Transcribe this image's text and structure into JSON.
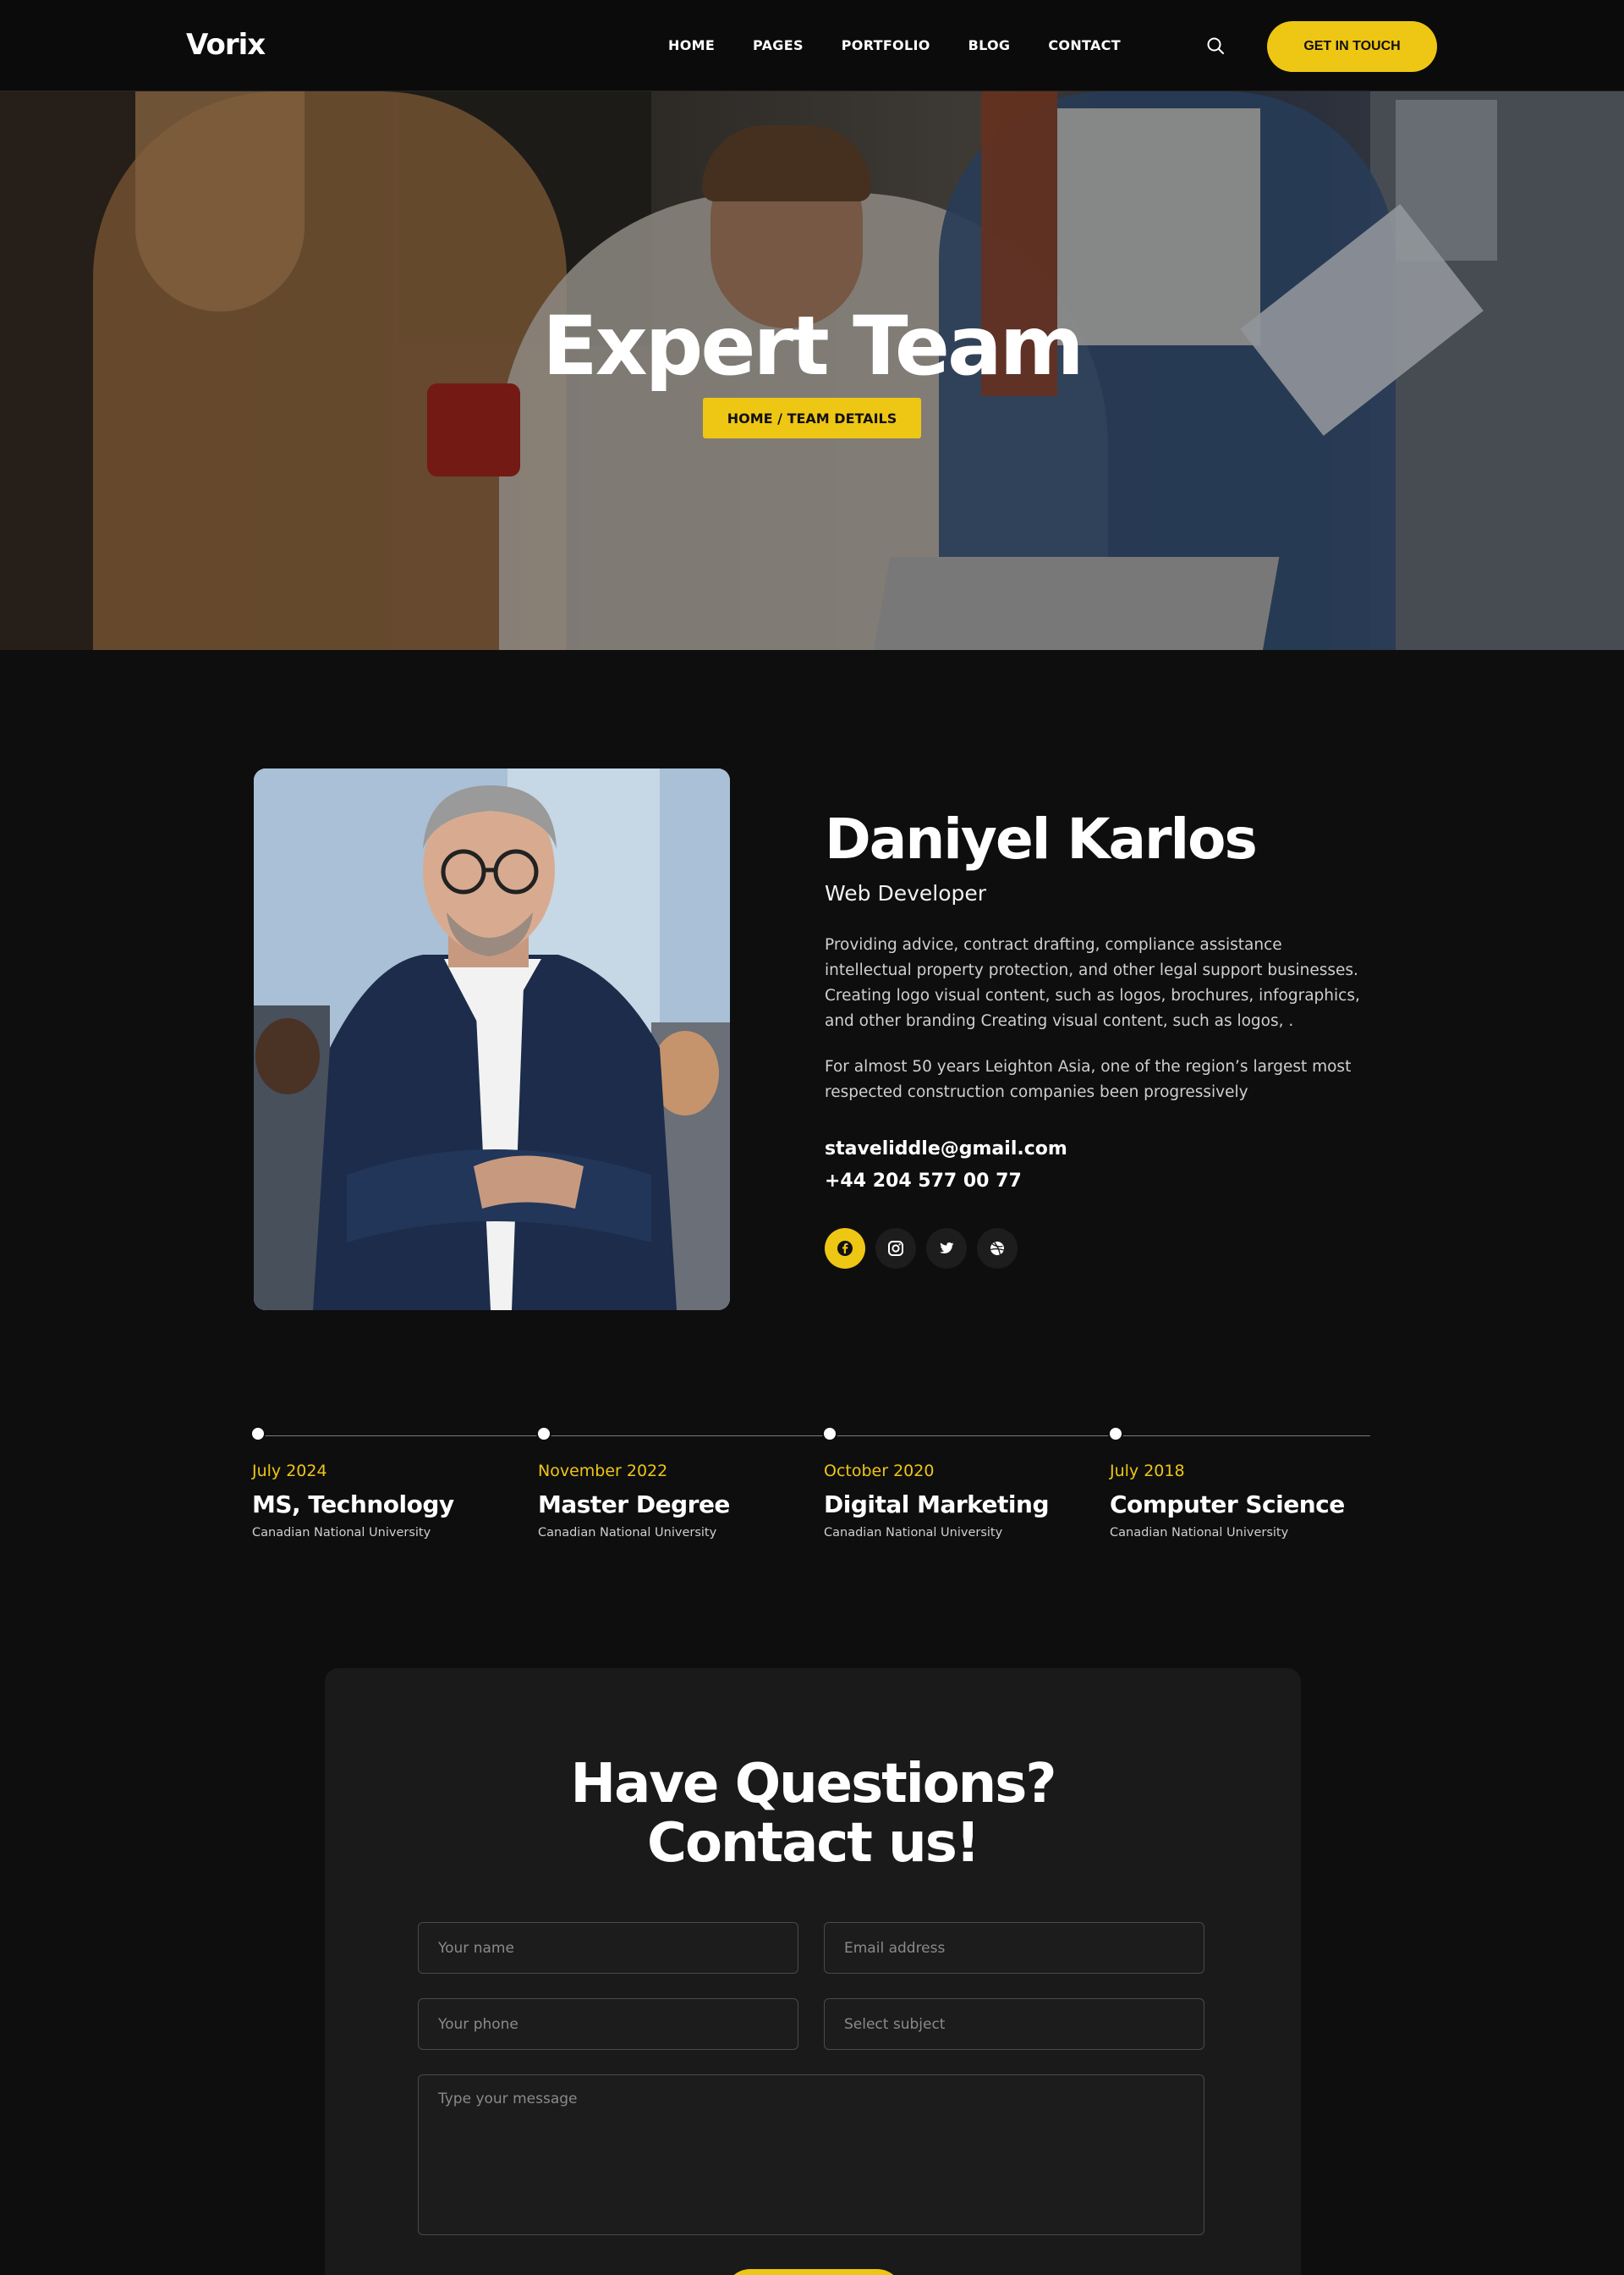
{
  "header": {
    "logo": "Vorix",
    "nav": [
      "HOME",
      "PAGES",
      "PORTFOLIO",
      "BLOG",
      "CONTACT"
    ],
    "cta_label": "GET IN TOUCH",
    "search_icon": "search-icon"
  },
  "hero": {
    "title": "Expert Team",
    "breadcrumb": "HOME / TEAM DETAILS"
  },
  "profile": {
    "name": "Daniyel Karlos",
    "role": "Web Developer",
    "bio_1": "Providing advice, contract drafting, compliance assistance intellectual property protection, and other legal support businesses. Creating logo visual content, such as logos, brochures, infographics, and other branding Creating visual content, such as logos, .",
    "bio_2": "For almost 50 years Leighton Asia, one of the region’s largest most respected construction companies been progressively",
    "email": "staveliddle@gmail.com",
    "phone": "+44 204 577 00 77",
    "socials": [
      "facebook-icon",
      "instagram-icon",
      "twitter-icon",
      "dribbble-icon"
    ]
  },
  "timeline": [
    {
      "date": "July 2024",
      "title": "MS, Technology",
      "school": "Canadian National University"
    },
    {
      "date": "November 2022",
      "title": "Master Degree",
      "school": "Canadian National University"
    },
    {
      "date": "October 2020",
      "title": "Digital Marketing",
      "school": "Canadian National University"
    },
    {
      "date": "July 2018",
      "title": "Computer Science",
      "school": "Canadian National University"
    }
  ],
  "contact": {
    "title_line1": "Have Questions?",
    "title_line2": "Contact us!",
    "name_placeholder": "Your name",
    "email_placeholder": "Email address",
    "phone_placeholder": "Your phone",
    "subject_placeholder": "Select subject",
    "message_placeholder": "Type your message"
  },
  "colors": {
    "accent": "#eec614",
    "background": "#0e0e0e",
    "card": "#1a1a1a"
  }
}
